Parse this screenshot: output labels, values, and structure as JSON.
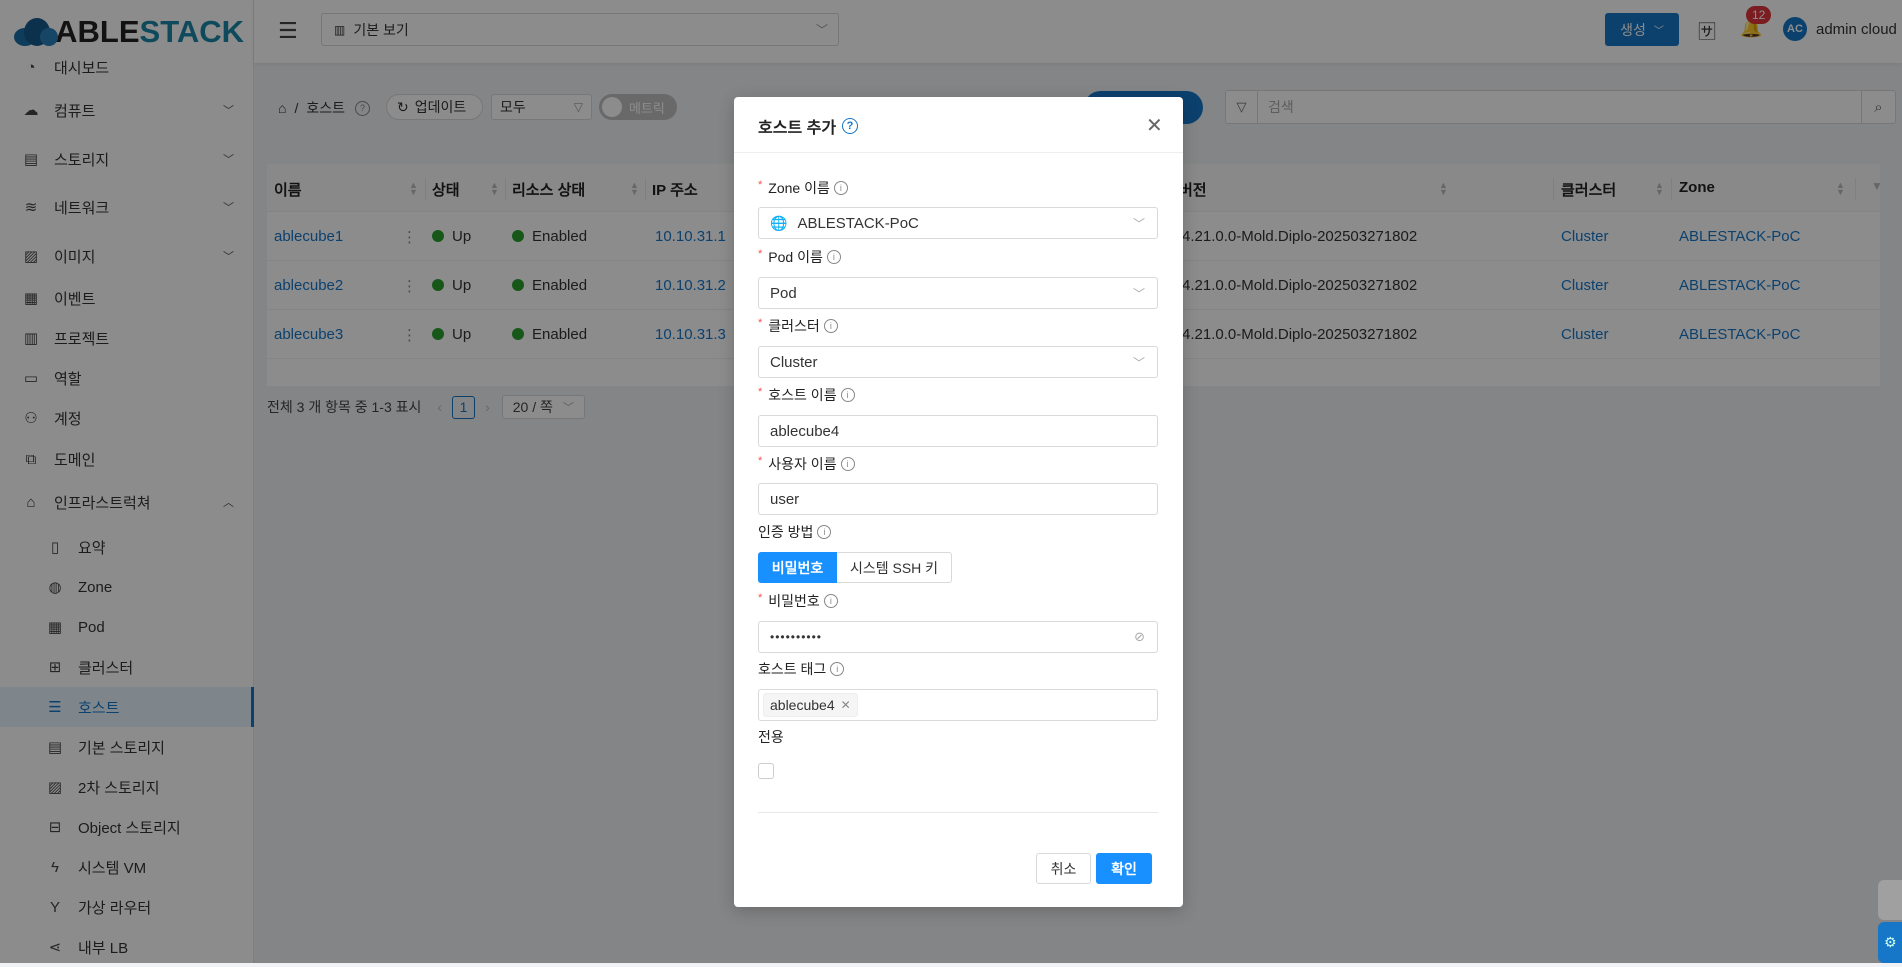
{
  "brand": {
    "part1": "ABLE",
    "part2": "STACK"
  },
  "header": {
    "view_select": "기본 보기",
    "create_label": "생성",
    "notification_count": "12",
    "avatar_initials": "AC",
    "username": "admin cloud"
  },
  "sidebar": {
    "items": [
      {
        "label": "대시보드",
        "icon": "dashboard-icon"
      },
      {
        "label": "컴퓨트",
        "icon": "cloud-icon"
      },
      {
        "label": "스토리지",
        "icon": "storage-icon"
      },
      {
        "label": "네트워크",
        "icon": "wifi-icon"
      },
      {
        "label": "이미지",
        "icon": "image-icon"
      },
      {
        "label": "이벤트",
        "icon": "schedule-icon"
      },
      {
        "label": "프로젝트",
        "icon": "project-icon"
      },
      {
        "label": "역할",
        "icon": "idcard-icon"
      },
      {
        "label": "계정",
        "icon": "team-icon"
      },
      {
        "label": "도메인",
        "icon": "block-icon"
      },
      {
        "label": "인프라스트럭쳐",
        "icon": "bank-icon"
      }
    ],
    "sub_items": [
      {
        "label": "요약",
        "icon": "book-icon"
      },
      {
        "label": "Zone",
        "icon": "globe-icon"
      },
      {
        "label": "Pod",
        "icon": "appstore-icon"
      },
      {
        "label": "클러스터",
        "icon": "cluster-icon"
      },
      {
        "label": "호스트",
        "icon": "database-icon"
      },
      {
        "label": "기본 스토리지",
        "icon": "hdd-icon"
      },
      {
        "label": "2차 스토리지",
        "icon": "picture-icon"
      },
      {
        "label": "Object 스토리지",
        "icon": "object-icon"
      },
      {
        "label": "시스템 VM",
        "icon": "thunderbolt-icon"
      },
      {
        "label": "가상 라우터",
        "icon": "fork-icon"
      },
      {
        "label": "내부 LB",
        "icon": "share-icon"
      }
    ]
  },
  "toolbar": {
    "breadcrumb_page": "호스트",
    "refresh_label": "업데이트",
    "filter_value": "모두",
    "metric_label": "메트릭",
    "search_placeholder": "검색"
  },
  "table": {
    "columns": [
      "이름",
      "상태",
      "리소스 상태",
      "IP 주소",
      "버전",
      "클러스터",
      "Zone"
    ],
    "rows": [
      {
        "name": "ablecube1",
        "state": "Up",
        "resource_state": "Enabled",
        "ip": "10.10.31.1",
        "version": "4.21.0.0-Mold.Diplo-202503271802",
        "cluster": "Cluster",
        "zone": "ABLESTACK-PoC"
      },
      {
        "name": "ablecube2",
        "state": "Up",
        "resource_state": "Enabled",
        "ip": "10.10.31.2",
        "version": "4.21.0.0-Mold.Diplo-202503271802",
        "cluster": "Cluster",
        "zone": "ABLESTACK-PoC"
      },
      {
        "name": "ablecube3",
        "state": "Up",
        "resource_state": "Enabled",
        "ip": "10.10.31.3",
        "version": "4.21.0.0-Mold.Diplo-202503271802",
        "cluster": "Cluster",
        "zone": "ABLESTACK-PoC"
      }
    ]
  },
  "pagination": {
    "summary": "전체 3 개 항목 중 1-3 표시",
    "current_page": "1",
    "page_size": "20 / 쪽"
  },
  "modal": {
    "title": "호스트 추가",
    "zone_label": "Zone 이름",
    "zone_value": "ABLESTACK-PoC",
    "pod_label": "Pod 이름",
    "pod_value": "Pod",
    "cluster_label": "클러스터",
    "cluster_value": "Cluster",
    "hostname_label": "호스트 이름",
    "hostname_value": "ablecube4",
    "username_label": "사용자 이름",
    "username_value": "user",
    "auth_label": "인증 방법",
    "auth_options": [
      "비밀번호",
      "시스템 SSH 키"
    ],
    "password_label": "비밀번호",
    "password_value": "••••••••••",
    "hosttags_label": "호스트 태그",
    "hosttags": [
      "ablecube4"
    ],
    "dedicated_label": "전용",
    "cancel_label": "취소",
    "ok_label": "확인"
  },
  "colors": {
    "primary": "#1677c9",
    "button_primary": "#1890ff",
    "status_up": "#2aa12e",
    "badge": "#e0343b"
  }
}
